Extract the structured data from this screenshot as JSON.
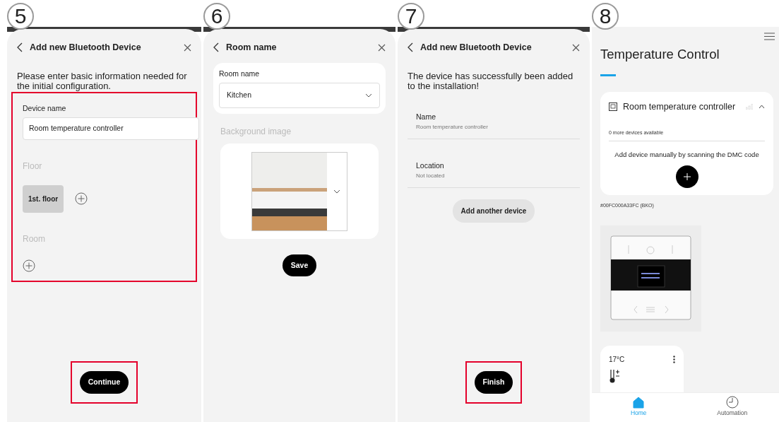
{
  "panels": [
    {
      "kind": "form",
      "step": "5",
      "title": "Add new Bluetooth Device",
      "intro": "Please enter basic information needed for the initial configuration.",
      "highlighted": true,
      "device_name": {
        "label": "Device name",
        "value": "Room temperature controller"
      },
      "floor": {
        "label": "Floor",
        "options": [
          {
            "label": "1st. floor",
            "selected": true
          }
        ]
      },
      "room": {
        "label": "Room"
      },
      "button": {
        "label": "Continue",
        "highlighted": true
      }
    },
    {
      "kind": "room",
      "step": "6",
      "title": "Room name",
      "room_name": {
        "label": "Room name",
        "value": "Kitchen"
      },
      "background": {
        "label": "Background image"
      },
      "button": {
        "label": "Save",
        "highlighted": false
      }
    },
    {
      "kind": "success",
      "step": "7",
      "title": "Add new Bluetooth Device",
      "intro": "The device has successfully been added to the installation!",
      "details": [
        {
          "label": "Name",
          "value": "Room temperature controller"
        },
        {
          "label": "Location",
          "value": "Not located"
        }
      ],
      "secondary_button": "Add another device",
      "button": {
        "label": "Finish",
        "highlighted": true
      }
    },
    {
      "kind": "home",
      "step": "8",
      "title": "Temperature Control",
      "device_card": {
        "name": "Room temperature controller",
        "expanded": true,
        "more": "0 more devices available",
        "hint": "Add device manually by scanning the DMC code"
      },
      "device_id": "#00FC000A33FC (BKO)",
      "tile": {
        "temperature": "17°C"
      },
      "nav": [
        {
          "label": "Home",
          "selected": true
        },
        {
          "label": "Automation",
          "selected": false
        }
      ]
    }
  ]
}
